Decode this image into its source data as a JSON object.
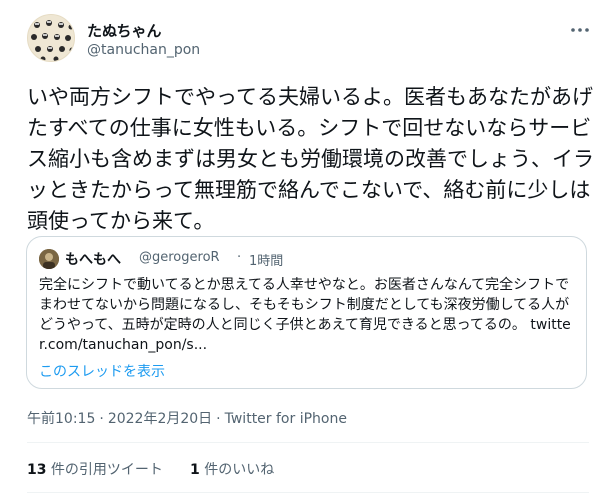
{
  "author": {
    "display_name": "たぬちゃん",
    "handle": "@tanuchan_pon"
  },
  "tweet": {
    "text": "いや両方シフトでやってる夫婦いるよ。医者もあなたがあげたすべての仕事に女性もいる。シフトで回せないならサービス縮小も含めまずは男女とも労働環境の改善でしょう、イラッときたからって無理筋で絡んでこないで、絡む前に少しは頭使ってから来て。",
    "more_icon": "more-horizontal-icon"
  },
  "quote": {
    "display_name": "もへもへ",
    "handle": "@gerogeroR",
    "separator": "·",
    "time": "1時間",
    "text": "完全にシフトで動いてるとか思えてる人幸せやなと。お医者さんなんて完全シフトでまわせてないから問題になるし、そもそもシフト制度だとしても深夜労働してる人がどうやって、五時が定時の人と同じく子供とあえて育児できると思ってるの。",
    "link": "twitter.com/tanuchan_pon/s...",
    "show_thread": "このスレッドを表示"
  },
  "meta": {
    "time": "午前10:15",
    "separator1": "·",
    "date": "2022年2月20日",
    "separator2": "·",
    "source": "Twitter for iPhone"
  },
  "stats": {
    "quotes_count": "13",
    "quotes_label": " 件の引用ツイート",
    "likes_count": "1",
    "likes_label": " 件のいいね"
  }
}
